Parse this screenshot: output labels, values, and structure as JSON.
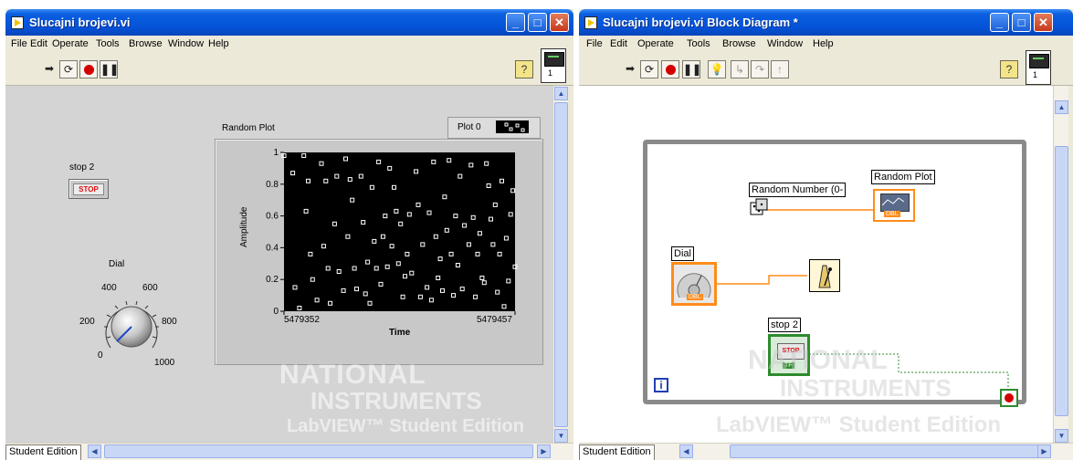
{
  "front_panel": {
    "title": "Slucajni brojevi.vi",
    "menu": [
      "File",
      "Edit",
      "Operate",
      "Tools",
      "Browse",
      "Window",
      "Help"
    ],
    "help_glyph": "?",
    "connector_number": "1",
    "stop": {
      "label": "stop 2",
      "button_text": "STOP"
    },
    "dial": {
      "label": "Dial",
      "scale": [
        "0",
        "200",
        "400",
        "600",
        "800",
        "1000"
      ],
      "value": 0
    },
    "graph": {
      "label": "Random Plot",
      "legend": "Plot 0",
      "y_axis_label": "Amplitude",
      "x_axis_label": "Time",
      "y_ticks": [
        "1",
        "0.8",
        "0.6",
        "0.4",
        "0.2",
        "0"
      ],
      "x_start": "5479352",
      "x_end": "5479457"
    },
    "status_context": "Student Edition",
    "watermark": {
      "line1": "NATIONAL",
      "line2": "INSTRUMENTS",
      "line3": "LabVIEW™ Student Edition"
    }
  },
  "chart_data": {
    "type": "scatter",
    "title": "Random Plot",
    "xlabel": "Time",
    "ylabel": "Amplitude",
    "xlim": [
      5479352,
      5479457
    ],
    "ylim": [
      0,
      1
    ],
    "x_tick_labels": [
      "5479352",
      "5479457"
    ],
    "y_tick_labels": [
      "0",
      "0.2",
      "0.4",
      "0.6",
      "0.8",
      "1"
    ],
    "legend": [
      "Plot 0"
    ],
    "series": [
      {
        "name": "Plot 0",
        "points": [
          [
            5479352,
            0.98
          ],
          [
            5479356,
            0.87
          ],
          [
            5479357,
            0.15
          ],
          [
            5479359,
            0.02
          ],
          [
            5479361,
            0.98
          ],
          [
            5479362,
            0.63
          ],
          [
            5479363,
            0.82
          ],
          [
            5479364,
            0.36
          ],
          [
            5479365,
            0.2
          ],
          [
            5479367,
            0.07
          ],
          [
            5479369,
            0.93
          ],
          [
            5479370,
            0.41
          ],
          [
            5479371,
            0.82
          ],
          [
            5479372,
            0.27
          ],
          [
            5479373,
            0.05
          ],
          [
            5479375,
            0.55
          ],
          [
            5479376,
            0.85
          ],
          [
            5479377,
            0.25
          ],
          [
            5479379,
            0.13
          ],
          [
            5479380,
            0.96
          ],
          [
            5479381,
            0.47
          ],
          [
            5479382,
            0.83
          ],
          [
            5479383,
            0.7
          ],
          [
            5479384,
            0.27
          ],
          [
            5479385,
            0.14
          ],
          [
            5479387,
            0.85
          ],
          [
            5479388,
            0.56
          ],
          [
            5479389,
            0.11
          ],
          [
            5479390,
            0.31
          ],
          [
            5479391,
            0.05
          ],
          [
            5479392,
            0.78
          ],
          [
            5479393,
            0.44
          ],
          [
            5479394,
            0.27
          ],
          [
            5479395,
            0.94
          ],
          [
            5479396,
            0.17
          ],
          [
            5479397,
            0.47
          ],
          [
            5479398,
            0.6
          ],
          [
            5479399,
            0.28
          ],
          [
            5479400,
            0.9
          ],
          [
            5479401,
            0.41
          ],
          [
            5479402,
            0.78
          ],
          [
            5479403,
            0.63
          ],
          [
            5479404,
            0.3
          ],
          [
            5479405,
            0.55
          ],
          [
            5479406,
            0.09
          ],
          [
            5479407,
            0.22
          ],
          [
            5479408,
            0.36
          ],
          [
            5479409,
            0.61
          ],
          [
            5479410,
            0.24
          ],
          [
            5479412,
            0.88
          ],
          [
            5479413,
            0.67
          ],
          [
            5479414,
            0.09
          ],
          [
            5479415,
            0.42
          ],
          [
            5479417,
            0.15
          ],
          [
            5479418,
            0.62
          ],
          [
            5479419,
            0.07
          ],
          [
            5479420,
            0.94
          ],
          [
            5479421,
            0.47
          ],
          [
            5479422,
            0.21
          ],
          [
            5479423,
            0.33
          ],
          [
            5479424,
            0.13
          ],
          [
            5479425,
            0.72
          ],
          [
            5479426,
            0.51
          ],
          [
            5479427,
            0.95
          ],
          [
            5479428,
            0.36
          ],
          [
            5479429,
            0.1
          ],
          [
            5479430,
            0.6
          ],
          [
            5479431,
            0.29
          ],
          [
            5479432,
            0.85
          ],
          [
            5479433,
            0.14
          ],
          [
            5479434,
            0.54
          ],
          [
            5479436,
            0.42
          ],
          [
            5479437,
            0.92
          ],
          [
            5479438,
            0.59
          ],
          [
            5479439,
            0.09
          ],
          [
            5479440,
            0.36
          ],
          [
            5479441,
            0.49
          ],
          [
            5479442,
            0.21
          ],
          [
            5479443,
            0.18
          ],
          [
            5479444,
            0.93
          ],
          [
            5479445,
            0.79
          ],
          [
            5479446,
            0.58
          ],
          [
            5479447,
            0.42
          ],
          [
            5479448,
            0.67
          ],
          [
            5479449,
            0.12
          ],
          [
            5479450,
            0.36
          ],
          [
            5479451,
            0.82
          ],
          [
            5479452,
            0.03
          ],
          [
            5479453,
            0.46
          ],
          [
            5479454,
            0.19
          ],
          [
            5479455,
            0.61
          ],
          [
            5479456,
            0.76
          ],
          [
            5479457,
            0.28
          ]
        ]
      }
    ]
  },
  "block_diagram": {
    "title": "Slucajni brojevi.vi Block Diagram *",
    "menu": [
      "File",
      "Edit",
      "Operate",
      "Tools",
      "Browse",
      "Window",
      "Help"
    ],
    "help_glyph": "?",
    "connector_number": "1",
    "random_number_label": "Random Number (0-",
    "random_plot_label": "Random Plot",
    "dial_label": "Dial",
    "stop_label": "stop 2",
    "dbl_tag": "DBL",
    "tf_tag": "TF",
    "iteration_glyph": "i",
    "status_context": "Student Edition",
    "watermark": {
      "line1": "NATIONAL",
      "line2": "INSTRUMENTS",
      "line3": "LabVIEW™ Student Edition"
    }
  },
  "colors": {
    "title_bar": "#0552d8",
    "panel_bg": "#d4d4d4",
    "diagram_bg": "#ffffff",
    "graph_plot_bg": "#000000",
    "wire_orange": "#ff8c1a",
    "wire_green": "#2e8b2e",
    "loop_frame": "#8a8a8a"
  }
}
